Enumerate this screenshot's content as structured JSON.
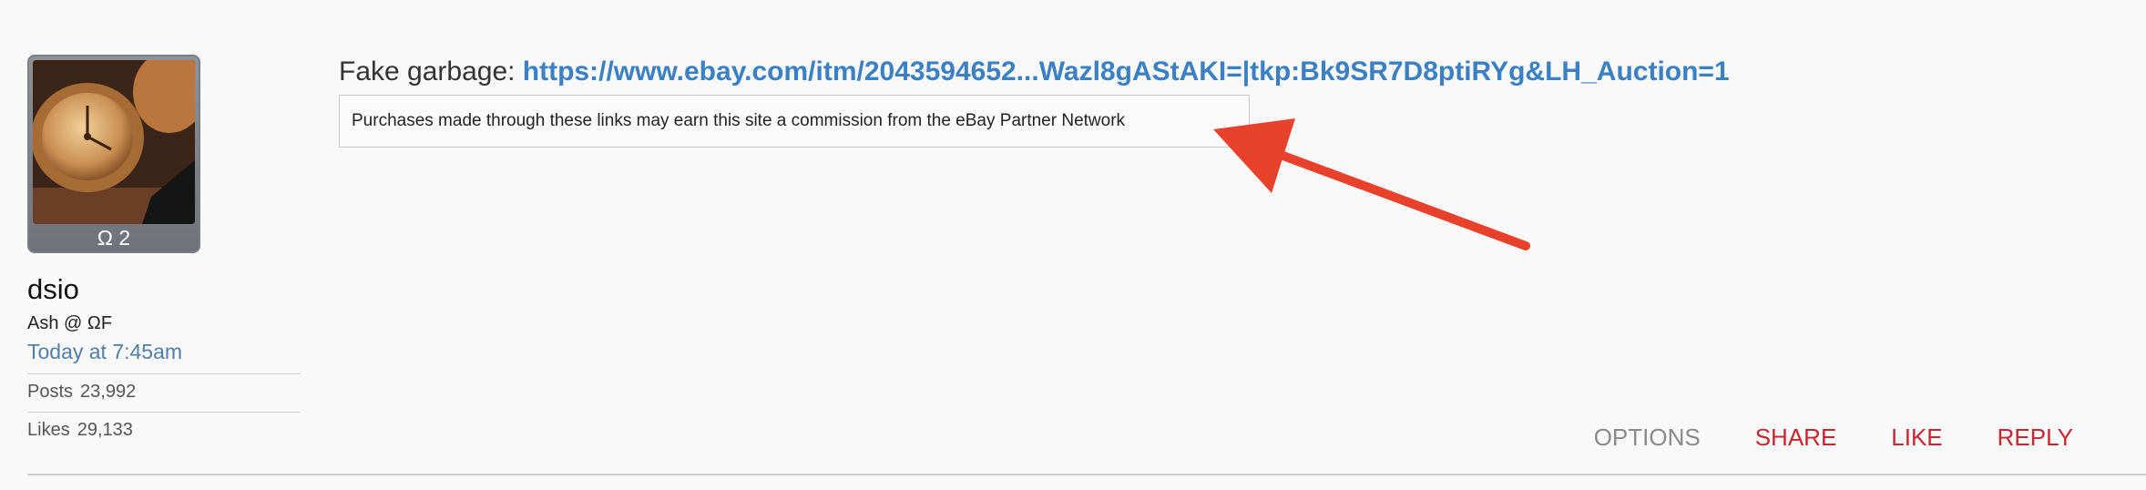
{
  "user": {
    "avatar_badge": "Ω 2",
    "name": "dsio",
    "title": "Ash @ ΩF",
    "post_time": "Today at 7:45am",
    "stats": [
      {
        "label": "Posts",
        "value": "23,992"
      },
      {
        "label": "Likes",
        "value": "29,133"
      }
    ]
  },
  "post": {
    "lead_text": "Fake garbage: ",
    "link_text": "https://www.ebay.com/itm/2043594652...Wazl8gAStAKI=|tkp:Bk9SR7D8ptiRYg&LH_Auction=1",
    "disclaimer": "Purchases made through these links may earn this site a commission from the eBay Partner Network"
  },
  "actions": {
    "options": "OPTIONS",
    "share": "SHARE",
    "like": "LIKE",
    "reply": "REPLY"
  },
  "colors": {
    "link": "#3b80c2",
    "action_red": "#c8252e",
    "arrow": "#e8412c"
  }
}
